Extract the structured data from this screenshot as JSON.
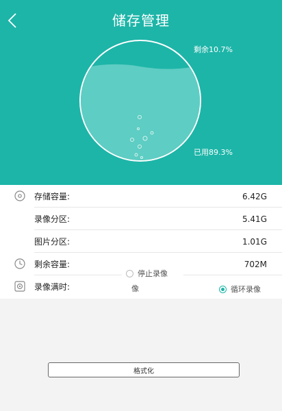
{
  "header": {
    "title": "储存管理",
    "back_icon": "chevron-left-icon"
  },
  "gauge": {
    "remaining_label": "剩余10.7%",
    "used_label": "已用89.3%",
    "used_fraction": 0.893
  },
  "colors": {
    "accent": "#1db5a8",
    "header_bg": "#1db5a8",
    "water": "#5ecdc3"
  },
  "rows": [
    {
      "label": "存储容量:",
      "value": "6.42G",
      "icon": "disc-icon"
    },
    {
      "label": "录像分区:",
      "value": "5.41G"
    },
    {
      "label": "图片分区:",
      "value": "1.01G"
    },
    {
      "label": "剩余容量:",
      "value": "702M",
      "icon": "clock-icon"
    },
    {
      "label": "录像满时:",
      "icon": "target-icon"
    }
  ],
  "record_options": {
    "stop": "停止录像",
    "stop_fragment": "像",
    "loop": "循环录像",
    "selected": "loop"
  },
  "format_button": "格式化"
}
